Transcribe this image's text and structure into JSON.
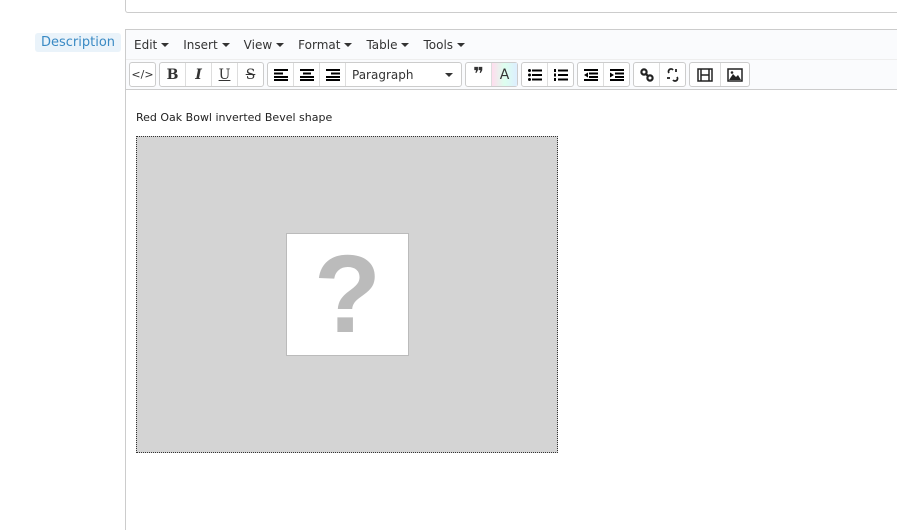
{
  "field_label": "Description",
  "menubar": [
    {
      "label": "Edit"
    },
    {
      "label": "Insert"
    },
    {
      "label": "View"
    },
    {
      "label": "Format"
    },
    {
      "label": "Table"
    },
    {
      "label": "Tools"
    }
  ],
  "toolbar": {
    "code": "</>",
    "bold": "B",
    "italic": "I",
    "underline": "U",
    "strike": "S",
    "block_format": "Paragraph"
  },
  "content": {
    "text": "Red Oak Bowl inverted Bevel shape",
    "image_placeholder": "?"
  }
}
